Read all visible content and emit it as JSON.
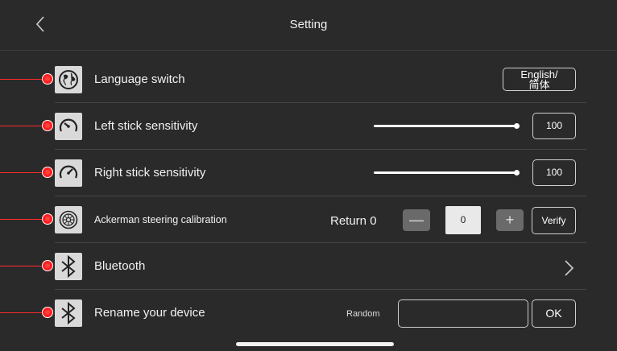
{
  "header": {
    "title": "Setting"
  },
  "rows": [
    {
      "id": "language",
      "label": "Language switch",
      "icon": "globe-icon",
      "value": "English/\n简体"
    },
    {
      "id": "left-stick",
      "label": "Left stick sensitivity",
      "icon": "gauge-low-icon",
      "value": "100",
      "slider_fraction": 1.0
    },
    {
      "id": "right-stick",
      "label": "Right stick sensitivity",
      "icon": "gauge-high-icon",
      "value": "100",
      "slider_fraction": 1.0
    },
    {
      "id": "ackerman",
      "label": "Ackerman steering calibration",
      "icon": "steering-wheel-icon",
      "return_label": "Return 0",
      "decrement": "—",
      "increment": "+",
      "value": "0",
      "verify_label": "Verify"
    },
    {
      "id": "bluetooth",
      "label": "Bluetooth",
      "icon": "bluetooth-icon",
      "action_icon": "chevron-right-icon"
    },
    {
      "id": "rename",
      "label": "Rename your device",
      "icon": "bluetooth-icon",
      "random_label": "Random",
      "input_value": "",
      "input_placeholder": "",
      "ok_label": "OK"
    }
  ],
  "colors": {
    "background": "#2a2a2a",
    "marker": "#ff1e1e",
    "icon_tile": "#d9d9d9",
    "stepper_button": "#6a6a6a"
  }
}
